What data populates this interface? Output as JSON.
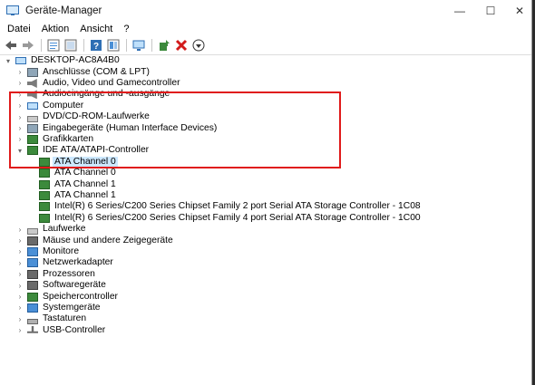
{
  "window": {
    "title": "Geräte-Manager",
    "controls": {
      "minimize": "—",
      "maximize": "☐",
      "close": "✕"
    }
  },
  "menu": [
    "Datei",
    "Aktion",
    "Ansicht",
    "?"
  ],
  "toolbar": [
    "back-icon",
    "forward-icon",
    "properties-icon",
    "list-icon",
    "help-icon",
    "details-icon",
    "monitor-scan-icon",
    "update-driver-icon",
    "uninstall-icon",
    "download-icon"
  ],
  "tree": {
    "root": "DESKTOP-AC8A4B0",
    "categories_top": [
      "Anschlüsse (COM & LPT)",
      "Audio, Video und Gamecontroller",
      "Audioeingänge und -ausgänge",
      "Computer",
      "DVD/CD-ROM-Laufwerke",
      "Eingabegeräte (Human Interface Devices)",
      "Grafikkarten"
    ],
    "expanded_category": "IDE ATA/ATAPI-Controller",
    "expanded_children": [
      "ATA Channel 0",
      "ATA Channel 0",
      "ATA Channel 1",
      "ATA Channel 1",
      "Intel(R) 6 Series/C200 Series Chipset Family 2 port Serial ATA Storage Controller - 1C08",
      "Intel(R) 6 Series/C200 Series Chipset Family 4 port Serial ATA Storage Controller - 1C00"
    ],
    "categories_bottom": [
      "Laufwerke",
      "Mäuse und andere Zeigegeräte",
      "Monitore",
      "Netzwerkadapter",
      "Prozessoren",
      "Softwaregeräte",
      "Speichercontroller",
      "Systemgeräte",
      "Tastaturen",
      "USB-Controller"
    ],
    "selected_child_index": 0
  },
  "colors": {
    "selection": "#cce8ff",
    "highlight_box": "#e01a1a"
  }
}
